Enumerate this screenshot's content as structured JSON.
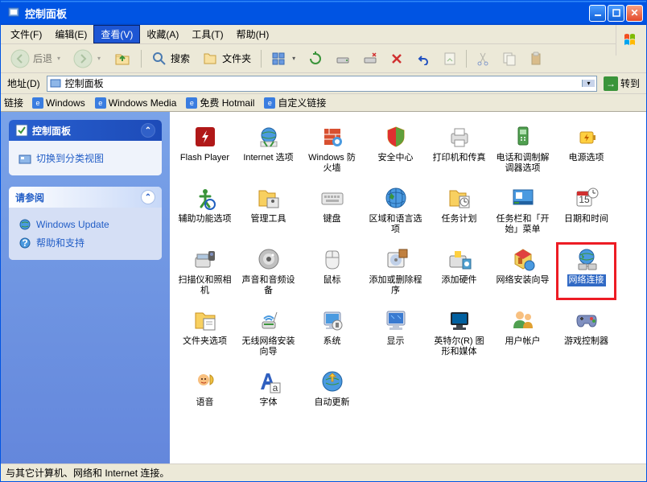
{
  "window": {
    "title": "控制面板"
  },
  "menu": {
    "file": "文件(F)",
    "edit": "编辑(E)",
    "view": "查看(V)",
    "favorites": "收藏(A)",
    "tools": "工具(T)",
    "help": "帮助(H)"
  },
  "toolbar": {
    "back": "后退",
    "search": "搜索",
    "folders": "文件夹"
  },
  "address": {
    "label": "地址(D)",
    "value": "控制面板",
    "go": "转到"
  },
  "links": {
    "label": "链接",
    "items": [
      "Windows",
      "Windows Media",
      "免费 Hotmail",
      "自定义链接"
    ]
  },
  "sidebar": {
    "panel1": {
      "title": "控制面板",
      "link": "切换到分类视图"
    },
    "panel2": {
      "title": "请参阅",
      "link1": "Windows Update",
      "link2": "帮助和支持"
    }
  },
  "items": [
    {
      "label": "Flash Player",
      "icon": "flash"
    },
    {
      "label": "Internet 选项",
      "icon": "internet"
    },
    {
      "label": "Windows 防火墙",
      "icon": "firewall"
    },
    {
      "label": "安全中心",
      "icon": "security"
    },
    {
      "label": "打印机和传真",
      "icon": "printer"
    },
    {
      "label": "电话和调制解调器选项",
      "icon": "phone"
    },
    {
      "label": "电源选项",
      "icon": "power"
    },
    {
      "label": "辅助功能选项",
      "icon": "accessibility"
    },
    {
      "label": "管理工具",
      "icon": "admin"
    },
    {
      "label": "键盘",
      "icon": "keyboard"
    },
    {
      "label": "区域和语言选项",
      "icon": "region"
    },
    {
      "label": "任务计划",
      "icon": "tasks"
    },
    {
      "label": "任务栏和「开始」菜单",
      "icon": "taskbar"
    },
    {
      "label": "日期和时间",
      "icon": "datetime"
    },
    {
      "label": "扫描仪和照相机",
      "icon": "scanner"
    },
    {
      "label": "声音和音频设备",
      "icon": "sound"
    },
    {
      "label": "鼠标",
      "icon": "mouse"
    },
    {
      "label": "添加或删除程序",
      "icon": "addremove"
    },
    {
      "label": "添加硬件",
      "icon": "addhw"
    },
    {
      "label": "网络安装向导",
      "icon": "netwiz"
    },
    {
      "label": "网络连接",
      "icon": "netconn",
      "selected": true,
      "highlighted": true
    },
    {
      "label": "文件夹选项",
      "icon": "folder"
    },
    {
      "label": "无线网络安装向导",
      "icon": "wireless"
    },
    {
      "label": "系统",
      "icon": "system"
    },
    {
      "label": "显示",
      "icon": "display"
    },
    {
      "label": "英特尔(R) 图形和媒体",
      "icon": "intel"
    },
    {
      "label": "用户帐户",
      "icon": "users"
    },
    {
      "label": "游戏控制器",
      "icon": "game"
    },
    {
      "label": "语音",
      "icon": "speech"
    },
    {
      "label": "字体",
      "icon": "fonts"
    },
    {
      "label": "自动更新",
      "icon": "update"
    }
  ],
  "status": "与其它计算机、网络和 Internet 连接。"
}
